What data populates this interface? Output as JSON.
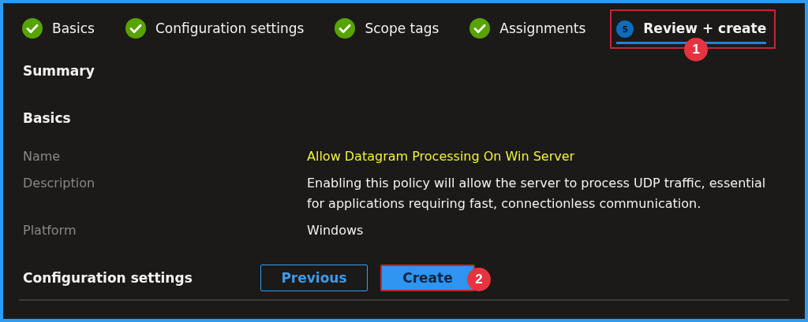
{
  "steps": [
    {
      "label": "Basics",
      "kind": "done",
      "selected": false
    },
    {
      "label": "Configuration settings",
      "kind": "done",
      "selected": false
    },
    {
      "label": "Scope tags",
      "kind": "done",
      "selected": false
    },
    {
      "label": "Assignments",
      "kind": "done",
      "selected": false
    },
    {
      "label": "Review + create",
      "kind": "current",
      "number": "5",
      "selected": true,
      "callout": "1"
    }
  ],
  "summary_title": "Summary",
  "section_title": "Basics",
  "fields": [
    {
      "label": "Name",
      "value": "Allow Datagram Processing On Win Server",
      "highlighted": true
    },
    {
      "label": "Description",
      "value": "Enabling this policy will allow the server to process UDP traffic, essential for applications requiring fast, connectionless communication.",
      "highlighted": false
    },
    {
      "label": "Platform",
      "value": "Windows",
      "highlighted": false
    }
  ],
  "next_section_title": "Configuration settings",
  "buttons": [
    {
      "label": "Previous",
      "kind": "secondary"
    },
    {
      "label": "Create",
      "kind": "primary",
      "callout": "2"
    }
  ]
}
